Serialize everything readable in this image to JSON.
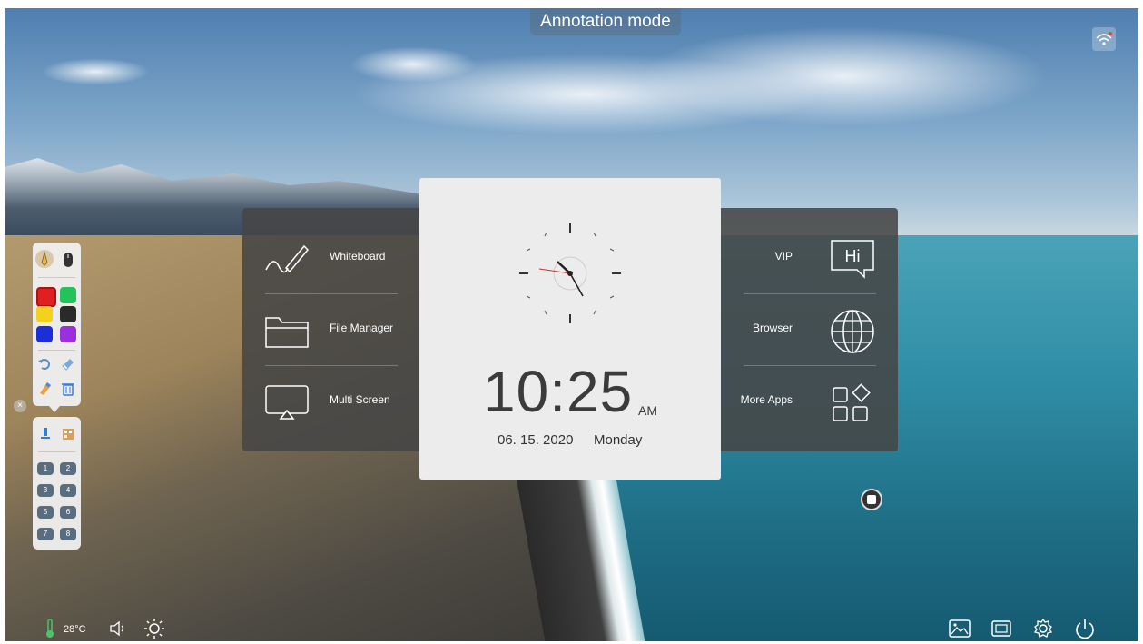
{
  "header": {
    "title": "Annotation mode"
  },
  "launcher_left": [
    {
      "label": "Whiteboard",
      "icon": "pen-stroke-icon"
    },
    {
      "label": "File Manager",
      "icon": "folder-icon"
    },
    {
      "label": "Multi Screen",
      "icon": "cast-screen-icon"
    }
  ],
  "launcher_right": [
    {
      "label": "VIP",
      "icon": "hi-chat-icon"
    },
    {
      "label": "Browser",
      "icon": "globe-icon"
    },
    {
      "label": "More Apps",
      "icon": "apps-grid-icon"
    }
  ],
  "clock": {
    "time": "10:25",
    "ampm": "AM",
    "date": "06. 15. 2020",
    "day": "Monday"
  },
  "toolbar": {
    "colors": [
      "#e02020",
      "#22c35a",
      "#f2d21a",
      "#2a2a2a",
      "#1c2fd6",
      "#9b2fe0"
    ],
    "numbers": [
      "1",
      "2",
      "3",
      "4",
      "5",
      "6",
      "7",
      "8"
    ]
  },
  "status": {
    "temperature": "28°C"
  }
}
